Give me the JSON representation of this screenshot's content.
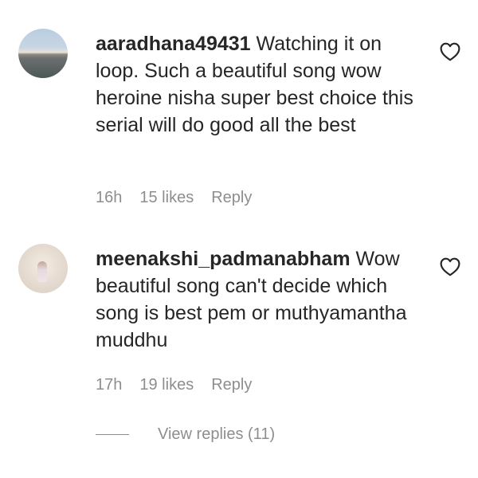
{
  "comments": [
    {
      "username": "aaradhana49431",
      "text": "Watching it on loop. Such a beautiful song wow heroine nisha super best choice this serial will do good all the best",
      "time": "16h",
      "likes": "15 likes",
      "reply_label": "Reply",
      "like_icon": "heart-outline-icon"
    },
    {
      "username": "meenakshi_padmanabham",
      "text": "Wow beautiful song can't decide which song is best pem or muthyamantha muddhu",
      "time": "17h",
      "likes": "19 likes",
      "reply_label": "Reply",
      "like_icon": "heart-outline-icon"
    }
  ],
  "view_replies": "View replies (11)",
  "colors": {
    "text": "#262626",
    "secondary": "#8e8e8e",
    "background": "#ffffff"
  }
}
